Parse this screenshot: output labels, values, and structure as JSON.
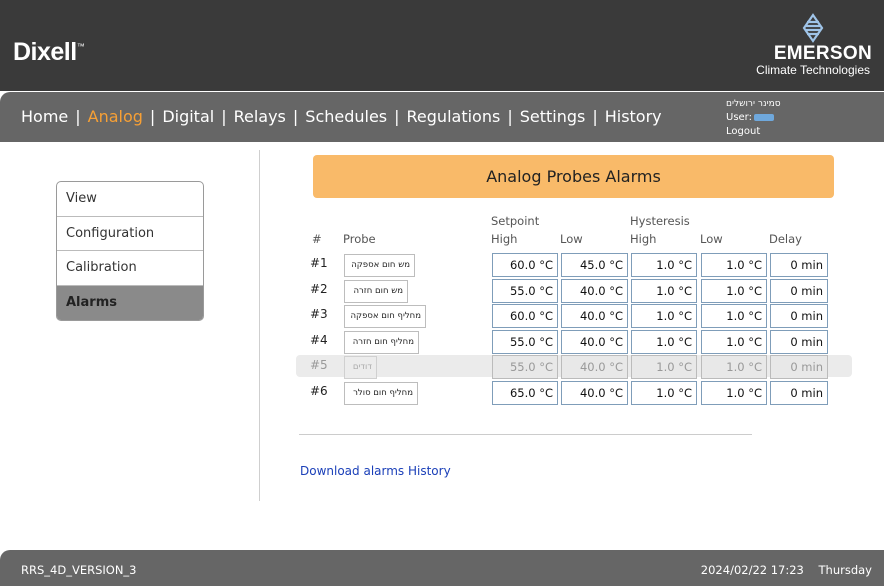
{
  "brand": {
    "logo": "Dixell",
    "logo_mark": "™",
    "partner_name": "EMERSON",
    "partner_sub": "Climate Technologies",
    "partner_icon": "emerson-logo-icon"
  },
  "nav": {
    "items": [
      "Home",
      "Analog",
      "Digital",
      "Relays",
      "Schedules",
      "Regulations",
      "Settings",
      "History"
    ],
    "active": "Analog",
    "separator": "|",
    "active_color": "#f7a035"
  },
  "user": {
    "site": "סמינר ירושלים",
    "user_label": "User:",
    "logout": "Logout"
  },
  "sidebar": {
    "items": [
      "View",
      "Configuration",
      "Calibration",
      "Alarms"
    ],
    "active": "Alarms"
  },
  "page": {
    "title": "Analog Probes Alarms",
    "headers": {
      "num": "#",
      "probe": "Probe",
      "setpoint": "Setpoint",
      "hysteresis": "Hysteresis",
      "high": "High",
      "low": "Low",
      "hyst_high": "High",
      "hyst_low": "Low",
      "delay": "Delay"
    },
    "rows": [
      {
        "num": "#1",
        "probe": "מש חום אספקה",
        "sp_high": "60.0 °C",
        "sp_low": "45.0 °C",
        "hy_high": "1.0 °C",
        "hy_low": "1.0 °C",
        "delay": "0 min",
        "disabled": false
      },
      {
        "num": "#2",
        "probe": "מש חום חזרה",
        "sp_high": "55.0 °C",
        "sp_low": "40.0 °C",
        "hy_high": "1.0 °C",
        "hy_low": "1.0 °C",
        "delay": "0 min",
        "disabled": false
      },
      {
        "num": "#3",
        "probe": "מחליף חום אספקה",
        "sp_high": "60.0 °C",
        "sp_low": "40.0 °C",
        "hy_high": "1.0 °C",
        "hy_low": "1.0 °C",
        "delay": "0 min",
        "disabled": false
      },
      {
        "num": "#4",
        "probe": "מחליף חום חזרה",
        "sp_high": "55.0 °C",
        "sp_low": "40.0 °C",
        "hy_high": "1.0 °C",
        "hy_low": "1.0 °C",
        "delay": "0 min",
        "disabled": false
      },
      {
        "num": "#5",
        "probe": "דודים",
        "sp_high": "55.0 °C",
        "sp_low": "40.0 °C",
        "hy_high": "1.0 °C",
        "hy_low": "1.0 °C",
        "delay": "0 min",
        "disabled": true
      },
      {
        "num": "#6",
        "probe": "מחליף חום סולר",
        "sp_high": "65.0 °C",
        "sp_low": "40.0 °C",
        "hy_high": "1.0 °C",
        "hy_low": "1.0 °C",
        "delay": "0 min",
        "disabled": false
      }
    ],
    "download_link": "Download alarms History"
  },
  "footer": {
    "version": "RRS_4D_VERSION_3",
    "datetime": "2024/02/22 17:23",
    "weekday": "Thursday"
  }
}
